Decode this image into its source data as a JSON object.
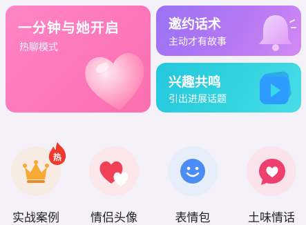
{
  "cards": [
    {
      "title": "一分钟与她开启",
      "subtitle": "热聊模式",
      "icon": "heart-balloon-icon"
    },
    {
      "title": "邀约话术",
      "subtitle": "主动才有故事",
      "icon": "bell-icon"
    },
    {
      "title": "兴趣共鸣",
      "subtitle": "引出进展话题",
      "icon": "video-play-icon"
    }
  ],
  "shortcuts": [
    {
      "label": "实战案例",
      "icon": "crown-icon",
      "badge": "热"
    },
    {
      "label": "情侣头像",
      "icon": "couple-hearts-icon"
    },
    {
      "label": "表情包",
      "icon": "smiley-icon"
    },
    {
      "label": "土味情话",
      "icon": "love-chat-bubble-icon"
    }
  ],
  "colors": {
    "pink_card": "#fd79bd",
    "purple_card": "#b577f3",
    "cyan_card": "#33d3df",
    "badge_red": "#f2372d",
    "background": "#f4f1f8"
  }
}
